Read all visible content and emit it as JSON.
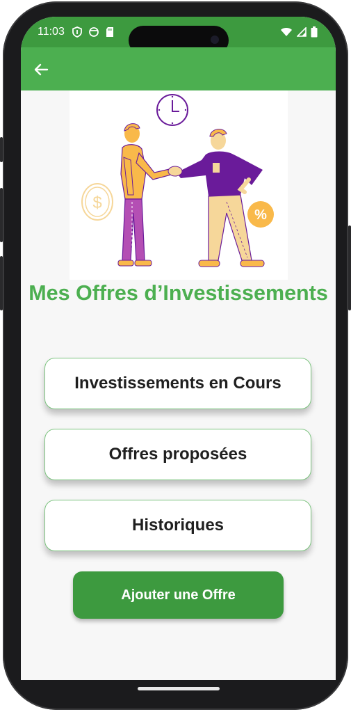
{
  "status_bar": {
    "time": "11:03",
    "left_icons": [
      "shield-icon",
      "circle-status-icon",
      "sd-card-icon"
    ],
    "right_icons": [
      "wifi-icon",
      "signal-icon",
      "battery-icon"
    ]
  },
  "app_bar": {
    "back_icon": "arrow-left-icon"
  },
  "page": {
    "title": "Mes Offres d’Investissements"
  },
  "menu": {
    "items": [
      {
        "label": "Investissements en Cours"
      },
      {
        "label": "Offres proposées"
      },
      {
        "label": "Historiques"
      }
    ]
  },
  "actions": {
    "add_offer_label": "Ajouter une Offre"
  },
  "colors": {
    "primary": "#4caf50",
    "primary_dark": "#3d9a3f",
    "background": "#f7f7f7",
    "illustration_purple": "#6a1b9a",
    "illustration_magenta": "#b44fb4",
    "illustration_orange": "#f9b94a",
    "illustration_sand": "#f6d79a"
  }
}
